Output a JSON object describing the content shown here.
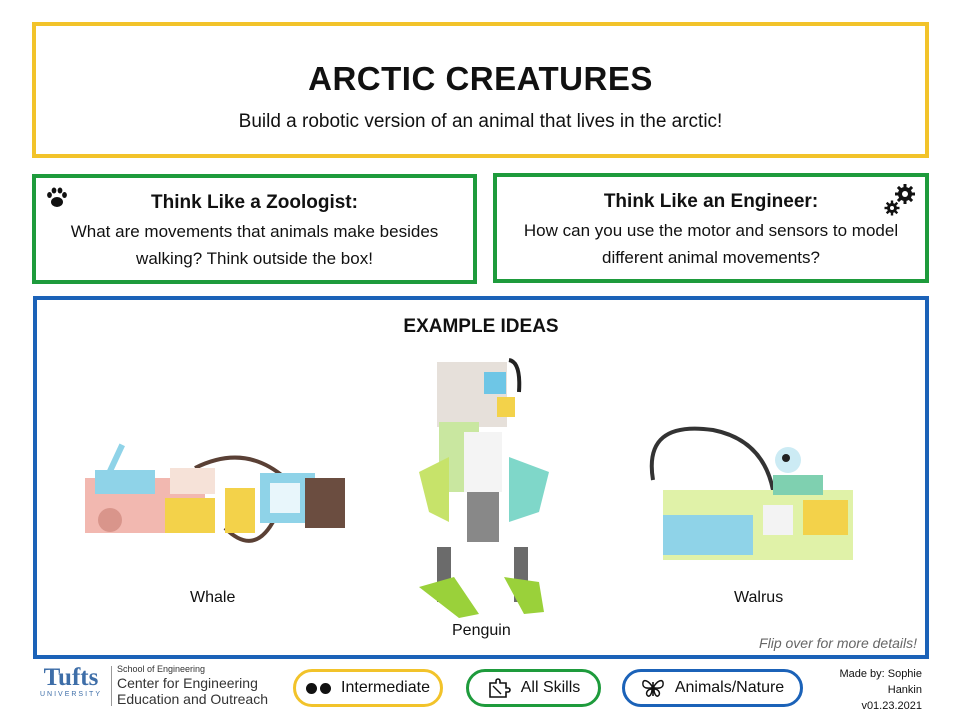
{
  "header": {
    "title": "ARCTIC CREATURES",
    "subtitle": "Build a robotic version of an animal that lives in the arctic!"
  },
  "zoologist": {
    "heading": "Think Like a Zoologist:",
    "question": "What are movements that animals make besides walking? Think outside the box!",
    "icon": "paw-icon"
  },
  "engineer": {
    "heading": "Think Like an Engineer:",
    "question": "How can you use the motor and sensors to model different animal movements?",
    "icon": "gears-icon"
  },
  "ideas": {
    "title": "EXAMPLE IDEAS",
    "examples": [
      "Whale",
      "Penguin",
      "Walrus"
    ],
    "flip_note": "Flip over for more details!"
  },
  "footer": {
    "logo": {
      "brand": "Tufts",
      "brand_sub": "UNIVERSITY",
      "school": "School of Engineering",
      "center_line1": "Center for Engineering",
      "center_line2": "Education and Outreach"
    },
    "tags": {
      "level": "Intermediate",
      "skills": "All Skills",
      "topic": "Animals/Nature"
    },
    "credit": {
      "line1": "Made by: Sophie",
      "line2": "Hankin",
      "version": "v01.23.2021"
    }
  },
  "colors": {
    "yellow": "#f2c32a",
    "green": "#1e9b3c",
    "blue": "#1b62b8",
    "tufts_blue": "#3e6ea8"
  }
}
